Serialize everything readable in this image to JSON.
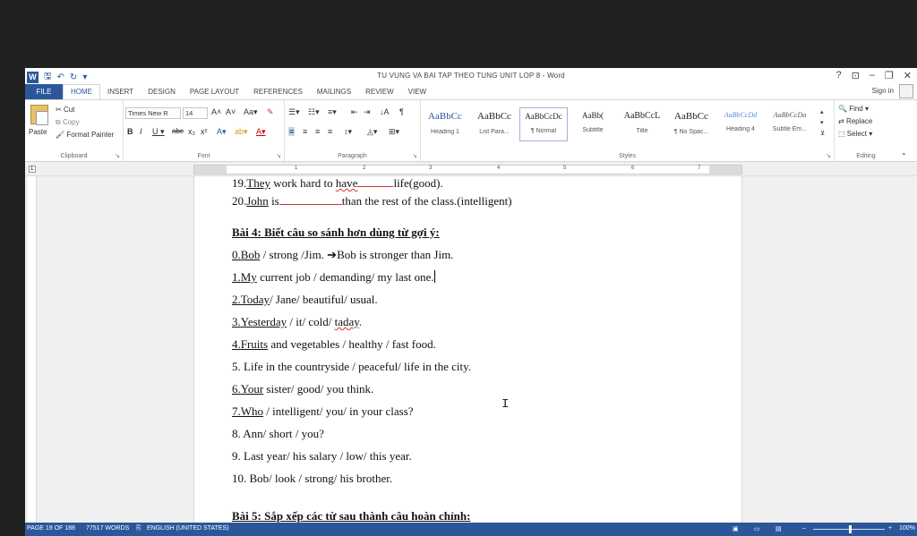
{
  "window": {
    "title": "TU VUNG VA BAI TAP THEO TUNG UNIT LOP 8 - Word",
    "controls": [
      "?",
      "⊡",
      "–",
      "❐",
      "✕"
    ]
  },
  "tabs": [
    "FILE",
    "HOME",
    "INSERT",
    "DESIGN",
    "PAGE LAYOUT",
    "REFERENCES",
    "MAILINGS",
    "REVIEW",
    "VIEW"
  ],
  "signin": "Sign in",
  "ribbon": {
    "clipboard": {
      "paste": "Paste",
      "cut": "Cut",
      "copy": "Copy",
      "format_painter": "Format Painter",
      "label": "Clipboard"
    },
    "font": {
      "name": "Times New R",
      "size": "14",
      "label": "Font"
    },
    "paragraph": {
      "label": "Paragraph"
    },
    "styles": {
      "label": "Styles",
      "items": [
        {
          "sample": "AaBbCc",
          "name": "Heading 1"
        },
        {
          "sample": "AaBbCc",
          "name": "List Para..."
        },
        {
          "sample": "AaBbCcDc",
          "name": "¶ Normal"
        },
        {
          "sample": "AaBb(",
          "name": "Subtitle"
        },
        {
          "sample": "AaBbCcL",
          "name": "Title"
        },
        {
          "sample": "AaBbCc",
          "name": "¶ No Spac..."
        },
        {
          "sample": "AaBbCcDd",
          "name": "Heading 4"
        },
        {
          "sample": "AaBbCcDa",
          "name": "Subtle Em..."
        }
      ]
    },
    "editing": {
      "find": "Find",
      "replace": "Replace",
      "select": "Select",
      "label": "Editing"
    }
  },
  "document": {
    "line19": {
      "num": "19.",
      "w1": "They",
      "mid": " work hard to ",
      "w2": "have",
      "tail": "life(good)."
    },
    "line20": {
      "num": "20.",
      "w1": "John",
      "mid": " is",
      "tail": "than the rest of the class.(intelligent)"
    },
    "heading4": "Bài 4: Biết câu so sánh hơn dùng từ gợi ý:",
    "ex0": {
      "num": "0.",
      "w1": "Bob",
      "rest": " / strong /Jim. ➔Bob is stronger than Jim."
    },
    "ex1": {
      "num": "1.",
      "w1": "My",
      "rest": " current job / demanding/ my last one."
    },
    "ex2": {
      "num": "2.",
      "w1": "Today",
      "rest": "/ Jane/ beautiful/ usual."
    },
    "ex3": {
      "num": "3.",
      "w1": "Yesterday",
      "mid": " / it/ cold/ ",
      "w2": "taday",
      "end": "."
    },
    "ex4": {
      "num": "4.",
      "w1": "Fruits",
      "rest": " and vegetables / healthy / fast food."
    },
    "ex5": "5. Life in the countryside / peaceful/ life in the city.",
    "ex6": {
      "num": "6.",
      "w1": "Your",
      "rest": " sister/ good/ you think."
    },
    "ex7": {
      "num": "7.",
      "w1": "Who",
      "rest": " / intelligent/ you/ in your class?"
    },
    "ex8": "8. Ann/ short / you?",
    "ex9": "9. Last year/ his salary / low/ this year.",
    "ex10": "10. Bob/ look / strong/ his brother.",
    "heading5": "Bài 5: Sắp xếp các từ sau thành câu hoàn chỉnh:"
  },
  "status": {
    "page": "PAGE 19 OF 188",
    "words": "77517 WORDS",
    "language": "ENGLISH (UNITED STATES)",
    "zoom": "100%",
    "zoom_value": 100
  },
  "colors": {
    "accent": "#2b579a"
  }
}
